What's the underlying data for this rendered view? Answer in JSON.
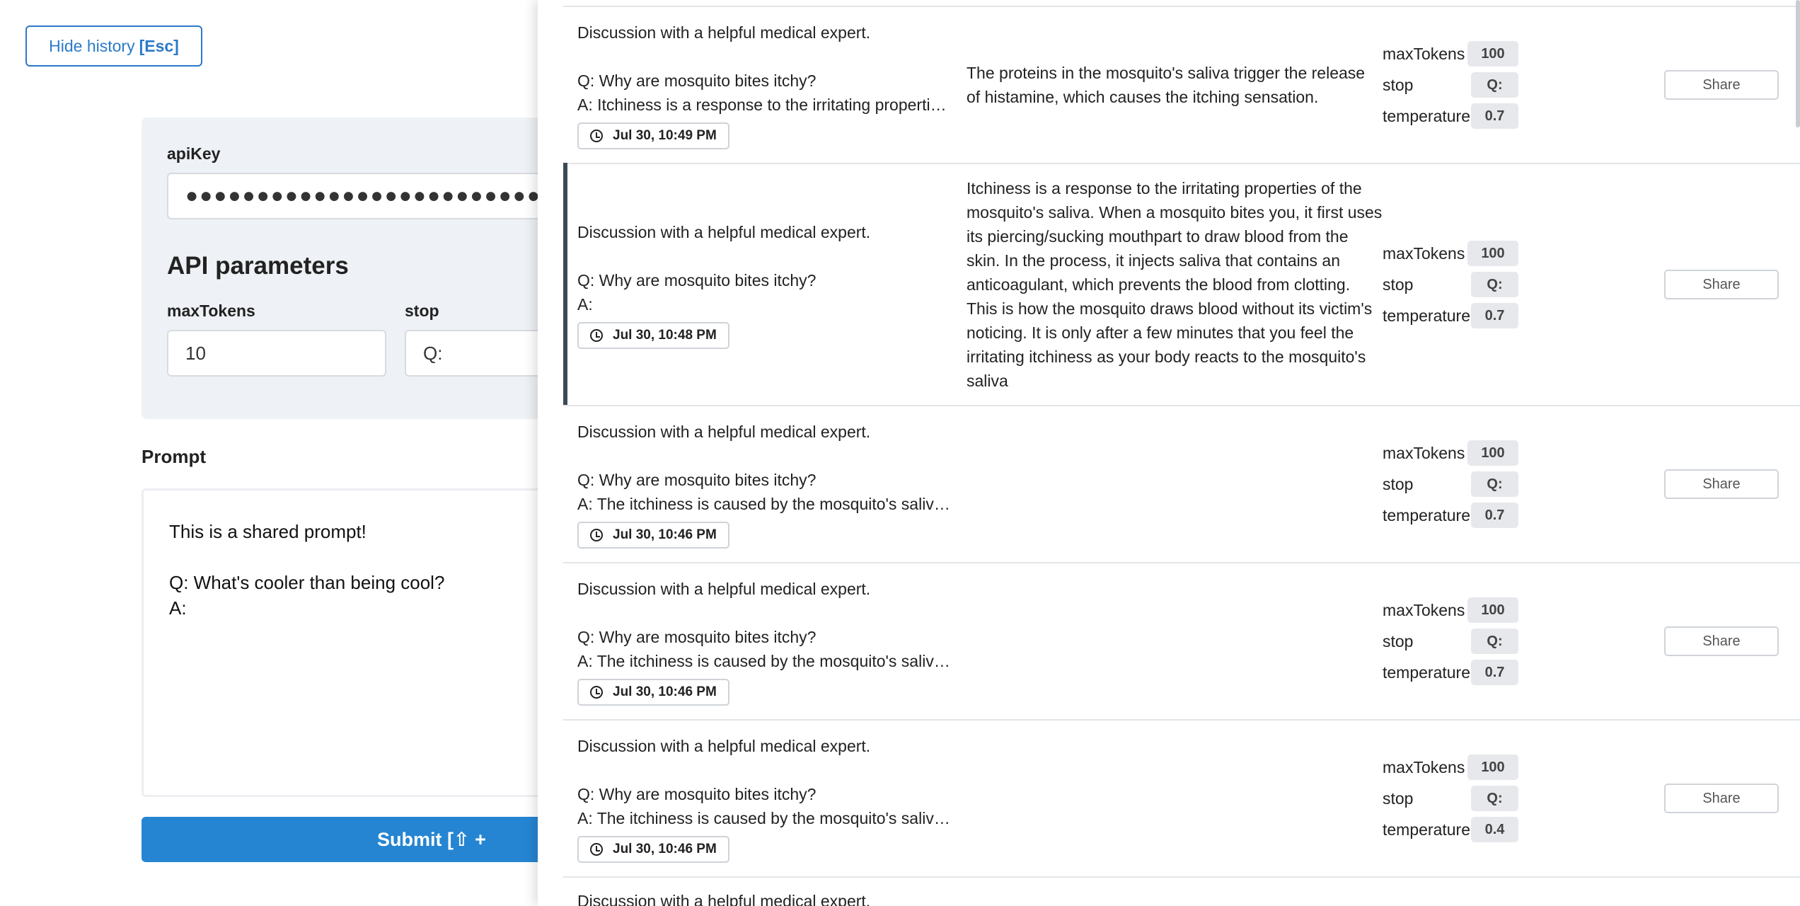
{
  "left": {
    "hide_history_label": "Hide history",
    "hide_history_shortcut": "[Esc]",
    "api_key_label": "apiKey",
    "api_key_value": "●●●●●●●●●●●●●●●●●●●●●●●●●●●●●●●●●●●●",
    "api_params_title": "API parameters",
    "max_tokens_label": "maxTokens",
    "max_tokens_value": "10",
    "stop_label": "stop",
    "stop_value": "Q:",
    "prompt_label": "Prompt",
    "prompt_text": "This is a shared prompt!\n\nQ: What's cooler than being cool?\nA:",
    "submit_label": "Submit [⇧ +"
  },
  "history": {
    "entries": [
      {
        "prompt_line1": "Discussion with a helpful medical expert.",
        "prompt_line2": "Q: Why are mosquito bites itchy?",
        "prompt_line3": "A: Itchiness is a response to the irritating properties…",
        "timestamp": "Jul 30, 10:49 PM",
        "completion": "The proteins in the mosquito's saliva trigger the release of histamine, which causes the itching sensation.",
        "max_tokens_label": "maxTokens",
        "max_tokens": "100",
        "stop_label": "stop",
        "stop": "Q:",
        "temperature_label": "temperature",
        "temperature": "0.7",
        "share_label": "Share"
      },
      {
        "prompt_line1": "Discussion with a helpful medical expert.",
        "prompt_line2": "Q: Why are mosquito bites itchy?",
        "prompt_line3": "A:",
        "timestamp": "Jul 30, 10:48 PM",
        "completion": "Itchiness is a response to the irritating properties of the mosquito's saliva. When a mosquito bites you, it first uses its piercing/sucking mouthpart to draw blood from the skin. In the process, it injects saliva that contains an anticoagulant, which prevents the blood from clotting. This is how the mosquito draws blood without its victim's noticing. It is only after a few minutes that you feel the irritating itchiness as your body reacts to the mosquito's saliva",
        "max_tokens_label": "maxTokens",
        "max_tokens": "100",
        "stop_label": "stop",
        "stop": "Q:",
        "temperature_label": "temperature",
        "temperature": "0.7",
        "share_label": "Share"
      },
      {
        "prompt_line1": "Discussion with a helpful medical expert.",
        "prompt_line2": "Q: Why are mosquito bites itchy?",
        "prompt_line3": "A: The itchiness is caused by the mosquito's saliva.…",
        "timestamp": "Jul 30, 10:46 PM",
        "completion": "",
        "max_tokens_label": "maxTokens",
        "max_tokens": "100",
        "stop_label": "stop",
        "stop": "Q:",
        "temperature_label": "temperature",
        "temperature": "0.7",
        "share_label": "Share"
      },
      {
        "prompt_line1": "Discussion with a helpful medical expert.",
        "prompt_line2": "Q: Why are mosquito bites itchy?",
        "prompt_line3": "A: The itchiness is caused by the mosquito's saliva.…",
        "timestamp": "Jul 30, 10:46 PM",
        "completion": "",
        "max_tokens_label": "maxTokens",
        "max_tokens": "100",
        "stop_label": "stop",
        "stop": "Q:",
        "temperature_label": "temperature",
        "temperature": "0.7",
        "share_label": "Share"
      },
      {
        "prompt_line1": "Discussion with a helpful medical expert.",
        "prompt_line2": "Q: Why are mosquito bites itchy?",
        "prompt_line3": "A: The itchiness is caused by the mosquito's saliva.…",
        "timestamp": "Jul 30, 10:46 PM",
        "completion": "",
        "max_tokens_label": "maxTokens",
        "max_tokens": "100",
        "stop_label": "stop",
        "stop": "Q:",
        "temperature_label": "temperature",
        "temperature": "0.4",
        "share_label": "Share"
      },
      {
        "prompt_line1": "Discussion with a helpful medical expert."
      }
    ]
  }
}
